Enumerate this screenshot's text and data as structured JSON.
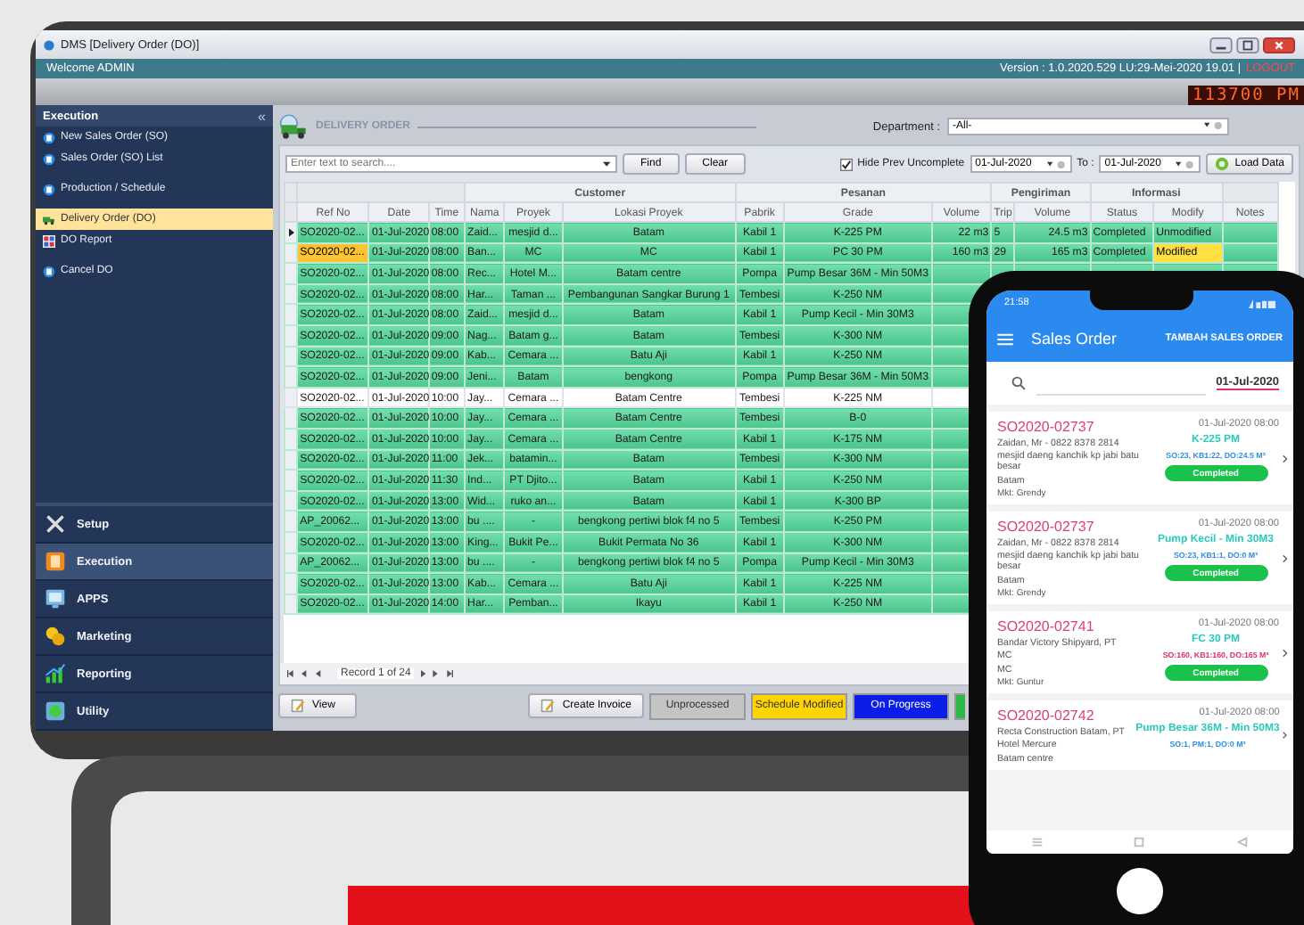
{
  "window": {
    "title": "DMS [Delivery Order (DO)]"
  },
  "header": {
    "welcome": "Welcome ADMIN",
    "version": "Version : 1.0.2020.529 LU:29-Mei-2020 19.01 |",
    "logout": "LOGOUT",
    "clock": "113700 PM"
  },
  "sidebar": {
    "title": "Execution",
    "collapse": "«",
    "items": [
      {
        "label": "New Sales Order (SO)",
        "selected": false
      },
      {
        "label": "Sales Order (SO) List",
        "selected": false
      },
      {
        "label": "Production / Schedule",
        "selected": false
      },
      {
        "label": "Delivery Order (DO)",
        "selected": true
      },
      {
        "label": "DO Report",
        "selected": false
      },
      {
        "label": "Cancel DO",
        "selected": false
      }
    ],
    "nav": [
      {
        "label": "Setup",
        "selected": false
      },
      {
        "label": "Execution",
        "selected": true
      },
      {
        "label": "APPS",
        "selected": false
      },
      {
        "label": "Marketing",
        "selected": false
      },
      {
        "label": "Reporting",
        "selected": false
      },
      {
        "label": "Utility",
        "selected": false
      }
    ]
  },
  "panel": {
    "title": "DELIVERY ORDER",
    "department_label": "Department :",
    "department": "-All-"
  },
  "toolbar": {
    "search_placeholder": "Enter text to search....",
    "find": "Find",
    "clear": "Clear",
    "hide_prev": {
      "label": "Hide Prev Uncomplete",
      "checked": true
    },
    "from": "01-Jul-2020",
    "to_label": "To :",
    "to": "01-Jul-2020",
    "load": "Load Data"
  },
  "table": {
    "column_groups": [
      {
        "columns": [
          "Ref No",
          "Date",
          "Time"
        ]
      },
      {
        "label": "Customer",
        "columns": [
          "Nama",
          "Proyek",
          "Lokasi Proyek"
        ]
      },
      {
        "label": "Pesanan",
        "columns": [
          "Pabrik",
          "Grade",
          "Volume"
        ]
      },
      {
        "label": "Pengiriman",
        "columns": [
          "Trip",
          "Volume"
        ]
      },
      {
        "label": "Informasi",
        "columns": [
          "Status",
          "Modify"
        ]
      },
      {
        "columns": [
          "Notes"
        ]
      }
    ],
    "rows": [
      {
        "current": true,
        "completed": true,
        "modified": false,
        "cells": [
          "SO2020-02...",
          "01-Jul-2020",
          "08:00",
          "Zaid...",
          "mesjid d...",
          "Batam",
          "Kabil 1",
          "K-225 PM",
          "22 m3",
          "5",
          "24.5 m3",
          "Completed",
          "Unmodified"
        ]
      },
      {
        "current": false,
        "completed": true,
        "modified": true,
        "cells": [
          "SO2020-02...",
          "01-Jul-2020",
          "08:00",
          "Ban...",
          "MC",
          "MC",
          "Kabil 1",
          "PC 30 PM",
          "160 m3",
          "29",
          "165 m3",
          "Completed",
          "Modified"
        ]
      },
      {
        "current": false,
        "completed": true,
        "modified": false,
        "cells": [
          "SO2020-02...",
          "01-Jul-2020",
          "08:00",
          "Rec...",
          "Hotel M...",
          "Batam centre",
          "Pompa",
          "Pump Besar 36M - Min 50M3"
        ]
      },
      {
        "current": false,
        "completed": true,
        "modified": false,
        "cells": [
          "SO2020-02...",
          "01-Jul-2020",
          "08:00",
          "Har...",
          "Taman ...",
          "Pembangunan Sangkar Burung 1",
          "Tembesi",
          "K-250 NM"
        ]
      },
      {
        "current": false,
        "completed": true,
        "modified": false,
        "cells": [
          "SO2020-02...",
          "01-Jul-2020",
          "08:00",
          "Zaid...",
          "mesjid d...",
          "Batam",
          "Kabil 1",
          "Pump Kecil - Min 30M3"
        ]
      },
      {
        "current": false,
        "completed": true,
        "modified": false,
        "cells": [
          "SO2020-02...",
          "01-Jul-2020",
          "09:00",
          "Nag...",
          "Batam g...",
          "Batam",
          "Tembesi",
          "K-300 NM"
        ]
      },
      {
        "current": false,
        "completed": true,
        "modified": false,
        "cells": [
          "SO2020-02...",
          "01-Jul-2020",
          "09:00",
          "Kab...",
          "Cemara ...",
          "Batu Aji",
          "Kabil 1",
          "K-250 NM"
        ]
      },
      {
        "current": false,
        "completed": true,
        "modified": false,
        "cells": [
          "SO2020-02...",
          "01-Jul-2020",
          "09:00",
          "Jeni...",
          "Batam",
          "bengkong",
          "Pompa",
          "Pump Besar 36M - Min 50M3"
        ]
      },
      {
        "current": false,
        "completed": false,
        "modified": false,
        "cells": [
          "SO2020-02...",
          "01-Jul-2020",
          "10:00",
          "Jay...",
          "Cemara ...",
          "Batam Centre",
          "Tembesi",
          "K-225 NM"
        ]
      },
      {
        "current": false,
        "completed": true,
        "modified": false,
        "cells": [
          "SO2020-02...",
          "01-Jul-2020",
          "10:00",
          "Jay...",
          "Cemara ...",
          "Batam Centre",
          "Tembesi",
          "B-0"
        ]
      },
      {
        "current": false,
        "completed": true,
        "modified": false,
        "cells": [
          "SO2020-02...",
          "01-Jul-2020",
          "10:00",
          "Jay...",
          "Cemara ...",
          "Batam Centre",
          "Kabil 1",
          "K-175 NM"
        ]
      },
      {
        "current": false,
        "completed": true,
        "modified": false,
        "cells": [
          "SO2020-02...",
          "01-Jul-2020",
          "11:00",
          "Jek...",
          "batamin...",
          "Batam",
          "Tembesi",
          "K-300 NM"
        ]
      },
      {
        "current": false,
        "completed": true,
        "modified": false,
        "cells": [
          "SO2020-02...",
          "01-Jul-2020",
          "11:30",
          "Ind...",
          "PT Djito...",
          "Batam",
          "Kabil 1",
          "K-250 NM"
        ]
      },
      {
        "current": false,
        "completed": true,
        "modified": false,
        "cells": [
          "SO2020-02...",
          "01-Jul-2020",
          "13:00",
          "Wid...",
          "ruko an...",
          "Batam",
          "Kabil 1",
          "K-300 BP"
        ]
      },
      {
        "current": false,
        "completed": true,
        "modified": false,
        "cells": [
          "AP_20062...",
          "01-Jul-2020",
          "13:00",
          "bu ....",
          "-",
          "bengkong pertiwi blok f4 no 5",
          "Tembesi",
          "K-250 PM"
        ]
      },
      {
        "current": false,
        "completed": true,
        "modified": false,
        "cells": [
          "SO2020-02...",
          "01-Jul-2020",
          "13:00",
          "King...",
          "Bukit Pe...",
          "Bukit Permata No 36",
          "Kabil 1",
          "K-300 NM"
        ]
      },
      {
        "current": false,
        "completed": true,
        "modified": false,
        "cells": [
          "AP_20062...",
          "01-Jul-2020",
          "13:00",
          "bu ....",
          "-",
          "bengkong pertiwi blok f4 no 5",
          "Pompa",
          "Pump Kecil - Min 30M3"
        ]
      },
      {
        "current": false,
        "completed": true,
        "modified": false,
        "cells": [
          "SO2020-02...",
          "01-Jul-2020",
          "13:00",
          "Kab...",
          "Cemara ...",
          "Batu Aji",
          "Kabil 1",
          "K-225 NM"
        ]
      },
      {
        "current": false,
        "completed": true,
        "modified": false,
        "cells": [
          "SO2020-02...",
          "01-Jul-2020",
          "14:00",
          "Har...",
          "Pemban...",
          "Ikayu",
          "Kabil 1",
          "K-250 NM"
        ]
      }
    ]
  },
  "navigator": {
    "record": "Record 1 of 24"
  },
  "footer": {
    "view": "View",
    "create_invoice": "Create Invoice",
    "legend": [
      {
        "label": "Unprocessed",
        "color": "#c4c4c4"
      },
      {
        "label": "Schedule Modified",
        "color": "#ffd400"
      },
      {
        "label": "On Progress",
        "color": "#0a1ee8"
      },
      {
        "color": "#2fb84a"
      }
    ]
  },
  "phone": {
    "time": "21:58",
    "title": "Sales Order",
    "action": "TAMBAH SALES ORDER",
    "date": "01-Jul-2020",
    "cards": [
      {
        "ref": "SO2020-02737",
        "datetime": "01-Jul-2020 08:00",
        "customer": "Zaidan, Mr - 0822 8378 2814",
        "grade": "K-225 PM",
        "project": "mesjid daeng kanchik kp jabi batu besar",
        "summary": "SO:23, KB1:22, DO:24.5 M³",
        "color": "#2f8fe0",
        "city": "Batam",
        "status": "Completed",
        "marketing": "Mkt: Grendy"
      },
      {
        "ref": "SO2020-02737",
        "datetime": "01-Jul-2020 08:00",
        "customer": "Zaidan, Mr - 0822 8378 2814",
        "grade": "Pump Kecil - Min 30M3",
        "project": "mesjid daeng kanchik kp jabi batu besar",
        "summary": "SO:23, KB1:1, DO:0 M³",
        "color": "#2f8fe0",
        "city": "Batam",
        "status": "Completed",
        "marketing": "Mkt: Grendy"
      },
      {
        "ref": "SO2020-02741",
        "datetime": "01-Jul-2020 08:00",
        "customer": "Bandar Victory Shipyard, PT",
        "grade": "FC 30 PM",
        "project": "MC",
        "summary": "SO:160, KB1:160, DO:165 M³",
        "color": "#e0306a",
        "city": "MC",
        "status": "Completed",
        "marketing": "Mkt: Guntur"
      },
      {
        "ref": "SO2020-02742",
        "datetime": "01-Jul-2020 08:00",
        "customer": "Recta Construction Batam, PT",
        "grade": "Pump Besar 36M - Min 50M3",
        "project": "Hotel Mercure",
        "summary": "SO:1, PM:1, DO:0 M³",
        "color": "#2f8fe0",
        "city": "Batam centre"
      }
    ]
  }
}
